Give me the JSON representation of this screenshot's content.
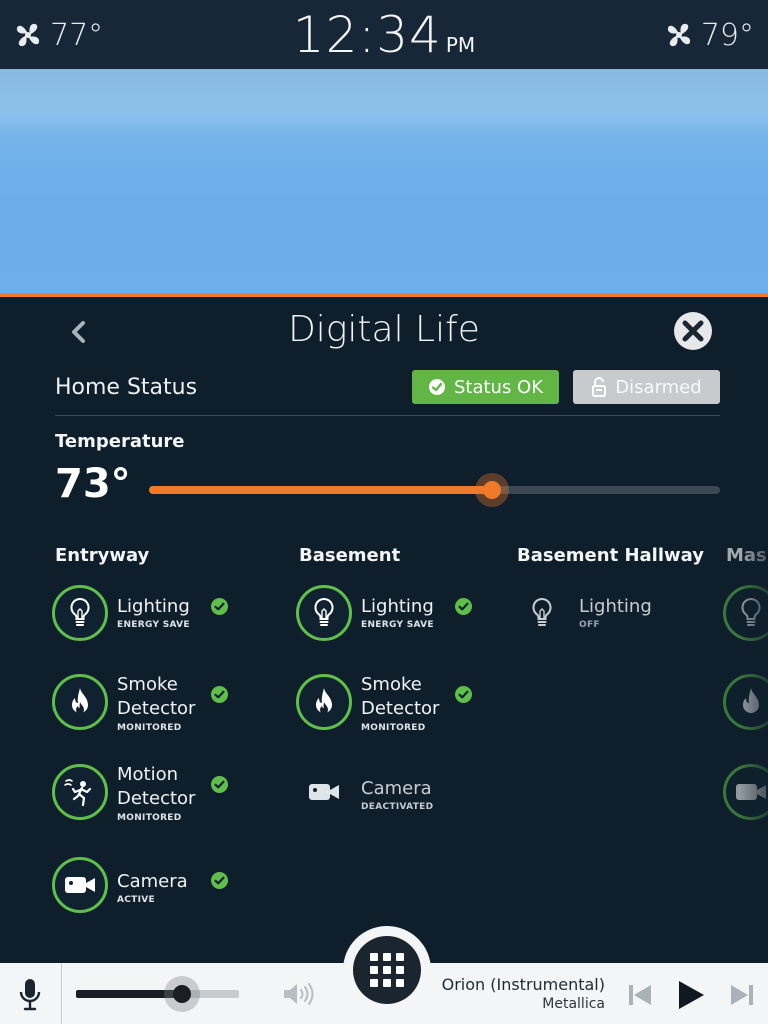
{
  "topbar": {
    "left_temp": "77°",
    "time": "12:34",
    "ampm": "PM",
    "right_temp": "79°",
    "left_icon": "fan-icon",
    "right_icon": "fan-icon"
  },
  "panel": {
    "title": "Digital Life",
    "home_status_label": "Home Status",
    "status_ok_label": "Status OK",
    "disarmed_label": "Disarmed",
    "temperature_label": "Temperature",
    "temperature_value": "73°",
    "temperature_slider_fraction": 0.6
  },
  "rooms": [
    {
      "title": "Entryway",
      "devices": [
        {
          "name": "Lighting",
          "status": "ENERGY SAVE",
          "icon": "lightbulb-icon",
          "ok": true
        },
        {
          "name": "Smoke Detector",
          "status": "MONITORED",
          "icon": "flame-icon",
          "ok": true
        },
        {
          "name": "Motion Detector",
          "status": "MONITORED",
          "icon": "motion-icon",
          "ok": true
        },
        {
          "name": "Camera",
          "status": "ACTIVE",
          "icon": "camera-icon",
          "ok": true
        }
      ]
    },
    {
      "title": "Basement",
      "devices": [
        {
          "name": "Lighting",
          "status": "ENERGY SAVE",
          "icon": "lightbulb-icon",
          "ok": true
        },
        {
          "name": "Smoke Detector",
          "status": "MONITORED",
          "icon": "flame-icon",
          "ok": true
        },
        {
          "name": "Camera",
          "status": "DEACTIVATED",
          "icon": "camera-icon",
          "ok": false
        }
      ]
    },
    {
      "title": "Basement Hallway",
      "devices": [
        {
          "name": "Lighting",
          "status": "OFF",
          "icon": "lightbulb-icon",
          "ok": false
        }
      ]
    },
    {
      "title": "Mas",
      "devices": []
    }
  ],
  "labels": {
    "smoke_line1": "Smoke",
    "motion_line1": "Motion",
    "detector_line2": "Detector"
  },
  "media": {
    "song_title": "Orion (Instrumental)",
    "artist": "Metallica",
    "volume_fraction": 0.65
  },
  "colors": {
    "accent": "#f07a2a",
    "ok_green": "#5ec04a",
    "panel_bg": "#0f1e2b",
    "status_ok_bg": "#62b646",
    "disarmed_bg": "#c8cbce"
  }
}
